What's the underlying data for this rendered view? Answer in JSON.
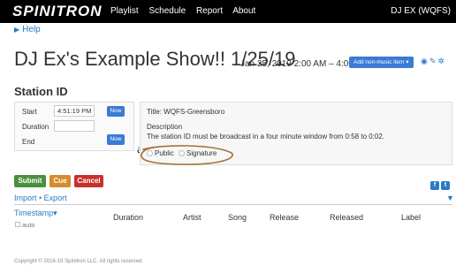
{
  "navbar": {
    "brand": "SPINITRON",
    "links": [
      "Playlist",
      "Schedule",
      "Report",
      "About"
    ],
    "user": "DJ EX (WQFS)"
  },
  "help": {
    "label": "Help"
  },
  "show": {
    "title": "DJ Ex's Example Show!! 1/25/19",
    "time": "Jan 25, 2019 2:00 AM – 4:00 AM",
    "add_button": "Add non-music item ▾"
  },
  "section": {
    "title": "Station ID"
  },
  "left_panel": {
    "start_label": "Start",
    "start_value": "4:51:19 PM",
    "duration_label": "Duration",
    "duration_value": "",
    "end_label": "End",
    "now_label": "Now"
  },
  "overflow_glyph": "a",
  "right_panel": {
    "title": "Title: WQFS-Greensboro",
    "description_label": "Description",
    "description": "The station ID must be broadcast in a four minute window from 0:58 to 0:02.",
    "public_label": "Public",
    "signature_label": "Signature"
  },
  "actions": {
    "submit": "Submit",
    "cue": "Cue",
    "cancel": "Cancel"
  },
  "share": {
    "facebook": "f",
    "twitter": "t"
  },
  "import_export": "Import • Export",
  "table": {
    "columns": [
      "Timestamp▾",
      "Duration",
      "Artist",
      "Song",
      "Release",
      "Released",
      "Label"
    ],
    "auto_label": "auto"
  },
  "footer": {
    "copyright": "Copyright © 2016-19 Spinitron LLC. All rights reserved."
  },
  "colors": {
    "accent": "#2a7ac8",
    "button_blue": "#3a7bd5",
    "submit": "#4b8f3d",
    "cue": "#d48c2c",
    "cancel": "#c9302c",
    "annotation": "#a5713a"
  },
  "icons": [
    "eye-icon",
    "pencil-icon",
    "gear-icon",
    "facebook-icon",
    "twitter-icon",
    "caret-down-icon",
    "caret-right-icon"
  ]
}
